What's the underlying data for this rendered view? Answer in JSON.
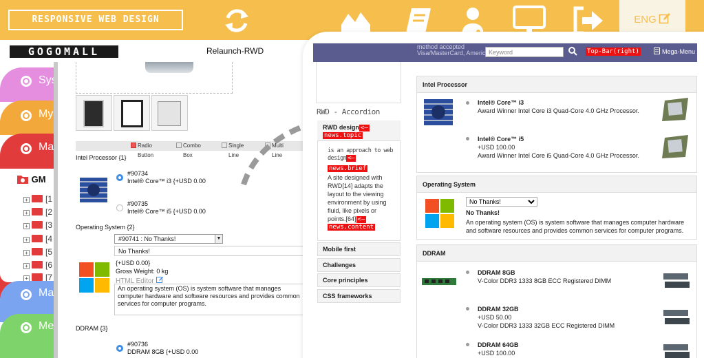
{
  "banner": {
    "title": "RESPONSIVE WEB DESIGN",
    "icons": [
      "refresh-icon",
      "chart-icon",
      "book-icon",
      "doctor-icon",
      "monitor-icon",
      "logout-icon"
    ],
    "lang_label": "ENG",
    "lang_icon": "edit-icon",
    "colors": {
      "banner": "#f6bf4d",
      "lang_box": "#f9f3e4"
    }
  },
  "left_page": {
    "logo": "GOGOMALL",
    "subtitle": "Relaunch-RWD",
    "side_tabs": [
      {
        "label": "Sys",
        "color": "#e58ddf"
      },
      {
        "label": "My",
        "color": "#f3a83b"
      },
      {
        "label": "Ma",
        "color": "#e23b3b"
      },
      {
        "label": "Ma",
        "color": "#7aa4ef"
      },
      {
        "label": "Me",
        "color": "#7ed36b"
      }
    ],
    "tree": {
      "root": "GM",
      "nodes": [
        "[1",
        "[2",
        "[3",
        "[4",
        "[5",
        "[6",
        "[7"
      ]
    },
    "legend": [
      "Radio Button",
      "Combo Box",
      "Single Line",
      "Multi Line"
    ],
    "intel_heading": "Intel Processor {1}",
    "intel_options": [
      {
        "code": "#90734",
        "name": "Intel® Core™ i3 {+USD 0.00"
      },
      {
        "code": "#90735",
        "name": "Intel® Core™ i5 {+USD 0.00"
      }
    ],
    "os_heading": "Operating System {2}",
    "os_select": "#90741 : No Thanks!",
    "os_selected": "No Thanks!",
    "os_price": "{+USD 0.00}",
    "os_weight": "Gross Weight: 0 kg",
    "os_editor": "HTML Editor",
    "os_desc": "An operating system (OS) is system software that manages computer hardware and software resources and provides common services for computer programs.",
    "ddram_heading": "DDRAM {3}",
    "ddram_option": {
      "code": "#90736",
      "name": "DDRAM 8GB {+USD 0.00"
    }
  },
  "right_page": {
    "topbar_behind": [
      "method accepted",
      "Visa/MasterCard, American Express, Discover"
    ],
    "search_placeholder": "Keyword",
    "topbar_tag": "Top-Bar(right)",
    "mega_menu": "Mega-Menu",
    "accordion_title": "RWD - Accordion",
    "accordion_open": {
      "topic": "RWD design",
      "topic_tag": "news.topic",
      "brief": "is an approach to web design",
      "brief_tag": "news.brief",
      "content": "A site designed with RWD[14] adapts the layout to the viewing environment by using fluid, like pixels or points.[64]",
      "content_tag": "news.content"
    },
    "accordion_items": [
      "Mobile first",
      "Challenges",
      "Core principles",
      "CSS frameworks"
    ],
    "intel": {
      "heading": "Intel Processor",
      "items": [
        {
          "name": "Intel® Core™ i3",
          "price": "",
          "desc": "Award Winner Intel Core i3 Quad-Core 4.0 GHz Processor."
        },
        {
          "name": "Intel® Core™ i5",
          "price": "+USD 100.00",
          "desc": "Award Winner Intel Core i5 Quad-Core 4.0 GHz Processor."
        }
      ]
    },
    "os": {
      "heading": "Operating System",
      "select_value": "No Thanks!",
      "selected": "No Thanks!",
      "desc": "An operating system (OS) is system software that manages computer hardware and software resources and provides common services for computer programs."
    },
    "ddram": {
      "heading": "DDRAM",
      "items": [
        {
          "name": "DDRAM 8GB",
          "price": "",
          "desc": "V-Color DDR3 1333 8GB ECC Registered DIMM"
        },
        {
          "name": "DDRAM 32GB",
          "price": "+USD 50.00",
          "desc": "V-Color DDR3 1333 32GB ECC Registered DIMM"
        },
        {
          "name": "DDRAM 64GB",
          "price": "+USD 100.00",
          "desc": ""
        }
      ]
    }
  }
}
